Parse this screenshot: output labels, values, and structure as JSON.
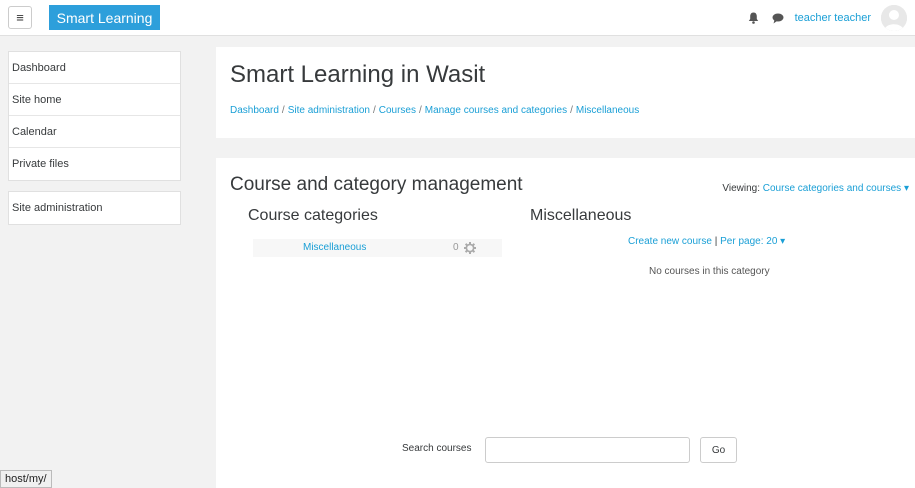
{
  "navbar": {
    "menu_icon": "hamburger-menu-icon",
    "brand": "Smart Learning",
    "bell_icon": "bell-icon",
    "messages_icon": "speech-bubble-icon",
    "username": "teacher teacher",
    "avatar_icon": "user-avatar-icon"
  },
  "sidebar": {
    "items": [
      {
        "label": "Dashboard"
      },
      {
        "label": "Site home"
      },
      {
        "label": "Calendar"
      },
      {
        "label": "Private files"
      }
    ],
    "admin": {
      "label": "Site administration"
    }
  },
  "status_url": "host/my/",
  "header": {
    "title": "Smart Learning in Wasit",
    "breadcrumb": [
      "Dashboard",
      "Site administration",
      "Courses",
      "Manage courses and categories",
      "Miscellaneous"
    ],
    "separator": "/"
  },
  "management": {
    "title": "Course and category management",
    "viewing_label": "Viewing:",
    "viewing_value": "Course categories and courses",
    "categories_heading": "Course categories",
    "category_heading": "Miscellaneous",
    "categories": [
      {
        "name": "Miscellaneous",
        "count": "0",
        "icon": "cog-icon"
      }
    ],
    "create_new_course": "Create new course",
    "pipe": "|",
    "per_page": "Per page: 20",
    "no_courses": "No courses in this category",
    "search_label": "Search courses",
    "search_value": "",
    "go_button": "Go"
  },
  "colors": {
    "accent": "#2d9fdb",
    "link": "#1a9fd6",
    "text": "#373a3c",
    "background": "#f2f2f2"
  }
}
